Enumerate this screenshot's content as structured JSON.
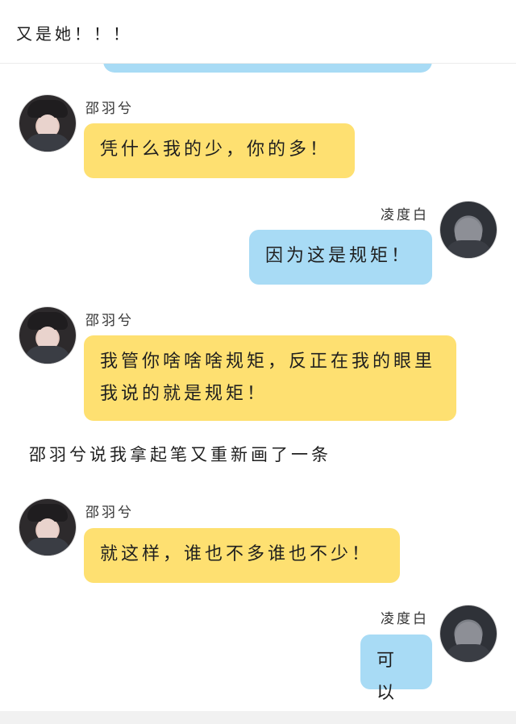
{
  "header": {
    "title": "又是她！！！"
  },
  "messages": [
    {
      "sender": "邵羽兮",
      "text": "凭什么我的少，你的多！",
      "side": "left"
    },
    {
      "sender": "凌度白",
      "text": "因为这是规矩！",
      "side": "right"
    },
    {
      "sender": "邵羽兮",
      "text": "我管你啥啥啥规矩，反正在我的眼里我说的就是规矩！",
      "side": "left"
    },
    {
      "sender": "邵羽兮",
      "text": "就这样，谁也不多谁也不少！",
      "side": "left"
    },
    {
      "sender": "凌度白",
      "text": "可以",
      "side": "right"
    }
  ],
  "narration": "邵羽兮说我拿起笔又重新画了一条",
  "colors": {
    "yellow_bubble": "#fee071",
    "blue_bubble": "#a8dbf5"
  }
}
